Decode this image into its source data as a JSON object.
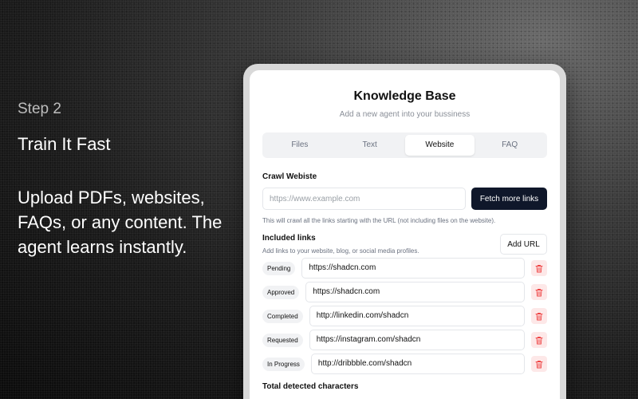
{
  "promo": {
    "step": "Step 2",
    "headline": "Train It Fast",
    "description": "Upload PDFs, websites, FAQs, or any content. The agent learns instantly."
  },
  "panel": {
    "title": "Knowledge Base",
    "subtitle": "Add a new agent into your bussiness",
    "tabs": [
      {
        "label": "Files",
        "active": false
      },
      {
        "label": "Text",
        "active": false
      },
      {
        "label": "Website",
        "active": true
      },
      {
        "label": "FAQ",
        "active": false
      }
    ],
    "crawl": {
      "label": "Crawl Webiste",
      "placeholder": "https://www.example.com",
      "button": "Fetch more links",
      "hint": "This will crawl all the links starting with the URL (not including files on the website)."
    },
    "included": {
      "label": "Included links",
      "subtitle": "Add links to your website, blog, or social media profiles.",
      "add_button": "Add URL",
      "links": [
        {
          "status": "Pending",
          "url": "https://shadcn.com"
        },
        {
          "status": "Approved",
          "url": "https://shadcn.com"
        },
        {
          "status": "Completed",
          "url": "http://linkedin.com/shadcn"
        },
        {
          "status": "Requested",
          "url": "https://instagram.com/shadcn"
        },
        {
          "status": "In Progress",
          "url": "http://dribbble.com/shadcn"
        }
      ]
    },
    "footer_label": "Total detected characters"
  },
  "colors": {
    "primary_button": "#0f172a",
    "delete_bg": "#fde8e8",
    "delete_icon": "#ef4444"
  },
  "icons": {
    "delete": "trash-icon"
  }
}
